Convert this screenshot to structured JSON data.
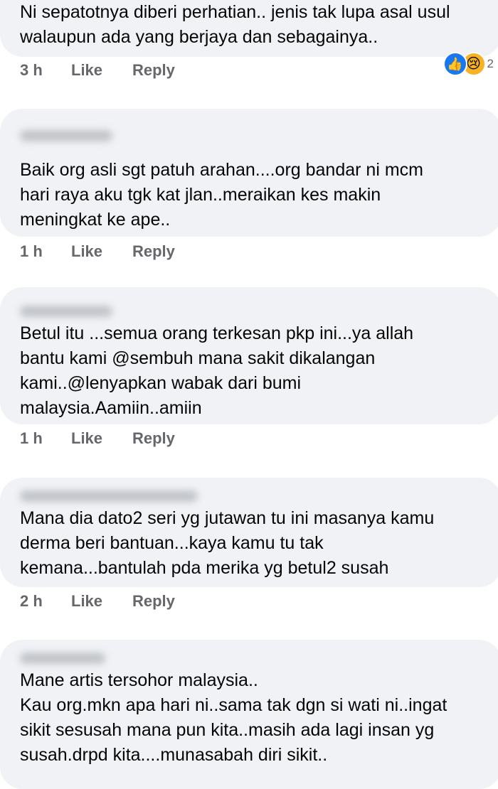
{
  "comments": [
    {
      "text": "Ni sepatotnya diberi perhatian.. jenis tak lupa asal usul\nwalaupun ada yang berjaya dan sebagainya..",
      "time": "3 h",
      "like": "Like",
      "reply": "Reply",
      "reactions": {
        "types": [
          "like-icon",
          "sad-icon"
        ],
        "count": "2",
        "colors": {
          "like": "#1877f2",
          "sad": "#f7b125"
        }
      }
    },
    {
      "text": "Baik org asli sgt patuh arahan....org bandar ni mcm\nhari raya aku tgk kat jlan..meraikan kes makin\nmeningkat ke ape..",
      "time": "1 h",
      "like": "Like",
      "reply": "Reply"
    },
    {
      "text": "Betul itu ...semua orang terkesan pkp ini...ya allah\nbantu kami @sembuh mana sakit dikalangan\nkami..@lenyapkan wabak dari bumi\nmalaysia.Aamiin..amiin",
      "time": "1 h",
      "like": "Like",
      "reply": "Reply"
    },
    {
      "text": "Mana dia dato2 seri yg jutawan tu ini masanya kamu\nderma beri bantuan...kaya kamu tu tak\nkemana...bantulah pda merika yg betul2 susah",
      "time": "2 h",
      "like": "Like",
      "reply": "Reply"
    },
    {
      "text": "Mane artis tersohor malaysia..\nKau org.mkn apa hari ni..sama tak dgn si wati ni..ingat\nsikit sesusah mana pun kita..masih ada lagi insan yg\nsusah.drpd kita....munasabah diri sikit.."
    }
  ],
  "theme": {
    "bubble": "#f0f2f5",
    "text": "#050505",
    "meta": "#65676b"
  }
}
